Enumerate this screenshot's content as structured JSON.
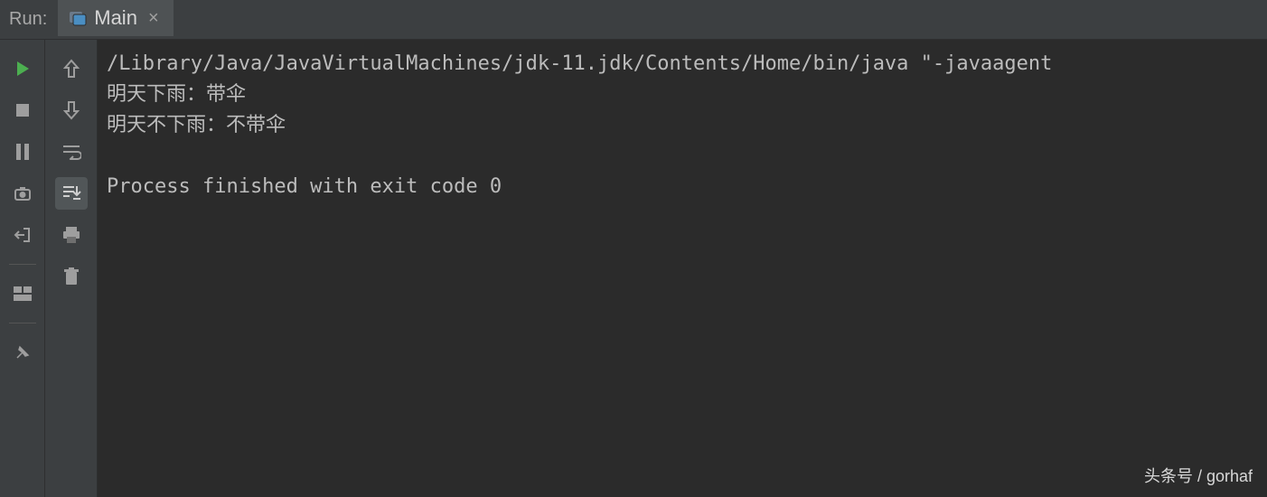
{
  "header": {
    "run_label": "Run:",
    "tab": {
      "name": "Main",
      "close_glyph": "×"
    }
  },
  "console": {
    "lines": [
      "/Library/Java/JavaVirtualMachines/jdk-11.jdk/Contents/Home/bin/java \"-javaagent",
      "明天下雨：带伞",
      "明天不下雨：不带伞",
      "",
      "Process finished with exit code 0"
    ]
  },
  "watermark": "头条号 / gorhaf"
}
